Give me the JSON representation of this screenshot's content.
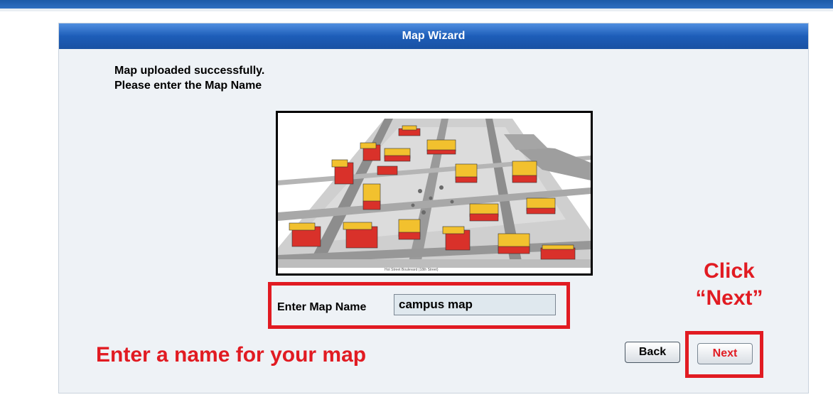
{
  "wizard": {
    "title": "Map Wizard",
    "message_line1": "Map uploaded successfully.",
    "message_line2": "Please enter the Map Name",
    "map_caption": "Hot Street Boulevard (18th Street)"
  },
  "form": {
    "name_label": "Enter Map Name",
    "name_value": "campus map"
  },
  "buttons": {
    "back_label": "Back",
    "next_label": "Next"
  },
  "annotations": {
    "enter_name": "Enter a name for your map",
    "click_line1": "Click",
    "click_line2": "“Next”"
  },
  "colors": {
    "header_blue": "#1d5db8",
    "annotation_red": "#e11b22",
    "building_red": "#d9312a",
    "building_yellow": "#f2c12e"
  }
}
